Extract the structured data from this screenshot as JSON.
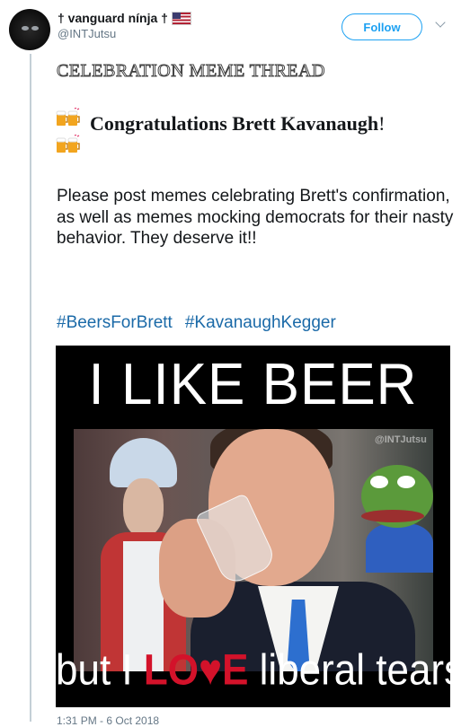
{
  "tweet": {
    "display_name_prefix": "† vanguarԁ nínja †",
    "handle": "@INTJutsu",
    "follow_label": "Follow",
    "thread_title": "CELEBRATION MEME THREAD",
    "congrats": {
      "bold": "Congratulations Brett Kavanaugh",
      "end": "!"
    },
    "body": "Please post memes celebrating Brett's confirmation, as well as memes mocking democrats for their nasty behavior.  They deserve it!!",
    "hashtags": [
      "#BeersForBrett",
      "#KavanaughKegger"
    ],
    "timestamp": "1:31 PM - 6 Oct 2018"
  },
  "meme": {
    "top_text": "I LIKE BEER",
    "bottom_before": "but I ",
    "bottom_love": "LO♥E",
    "bottom_after": " liberal tears!",
    "watermark": "@INTJutsu"
  },
  "colors": {
    "accent": "#1da1f2",
    "hashtag": "#1b6aa8",
    "love_red": "#d3122a"
  },
  "icons": [
    "us-flag-icon",
    "beer-mugs-icon",
    "chevron-down-icon"
  ]
}
